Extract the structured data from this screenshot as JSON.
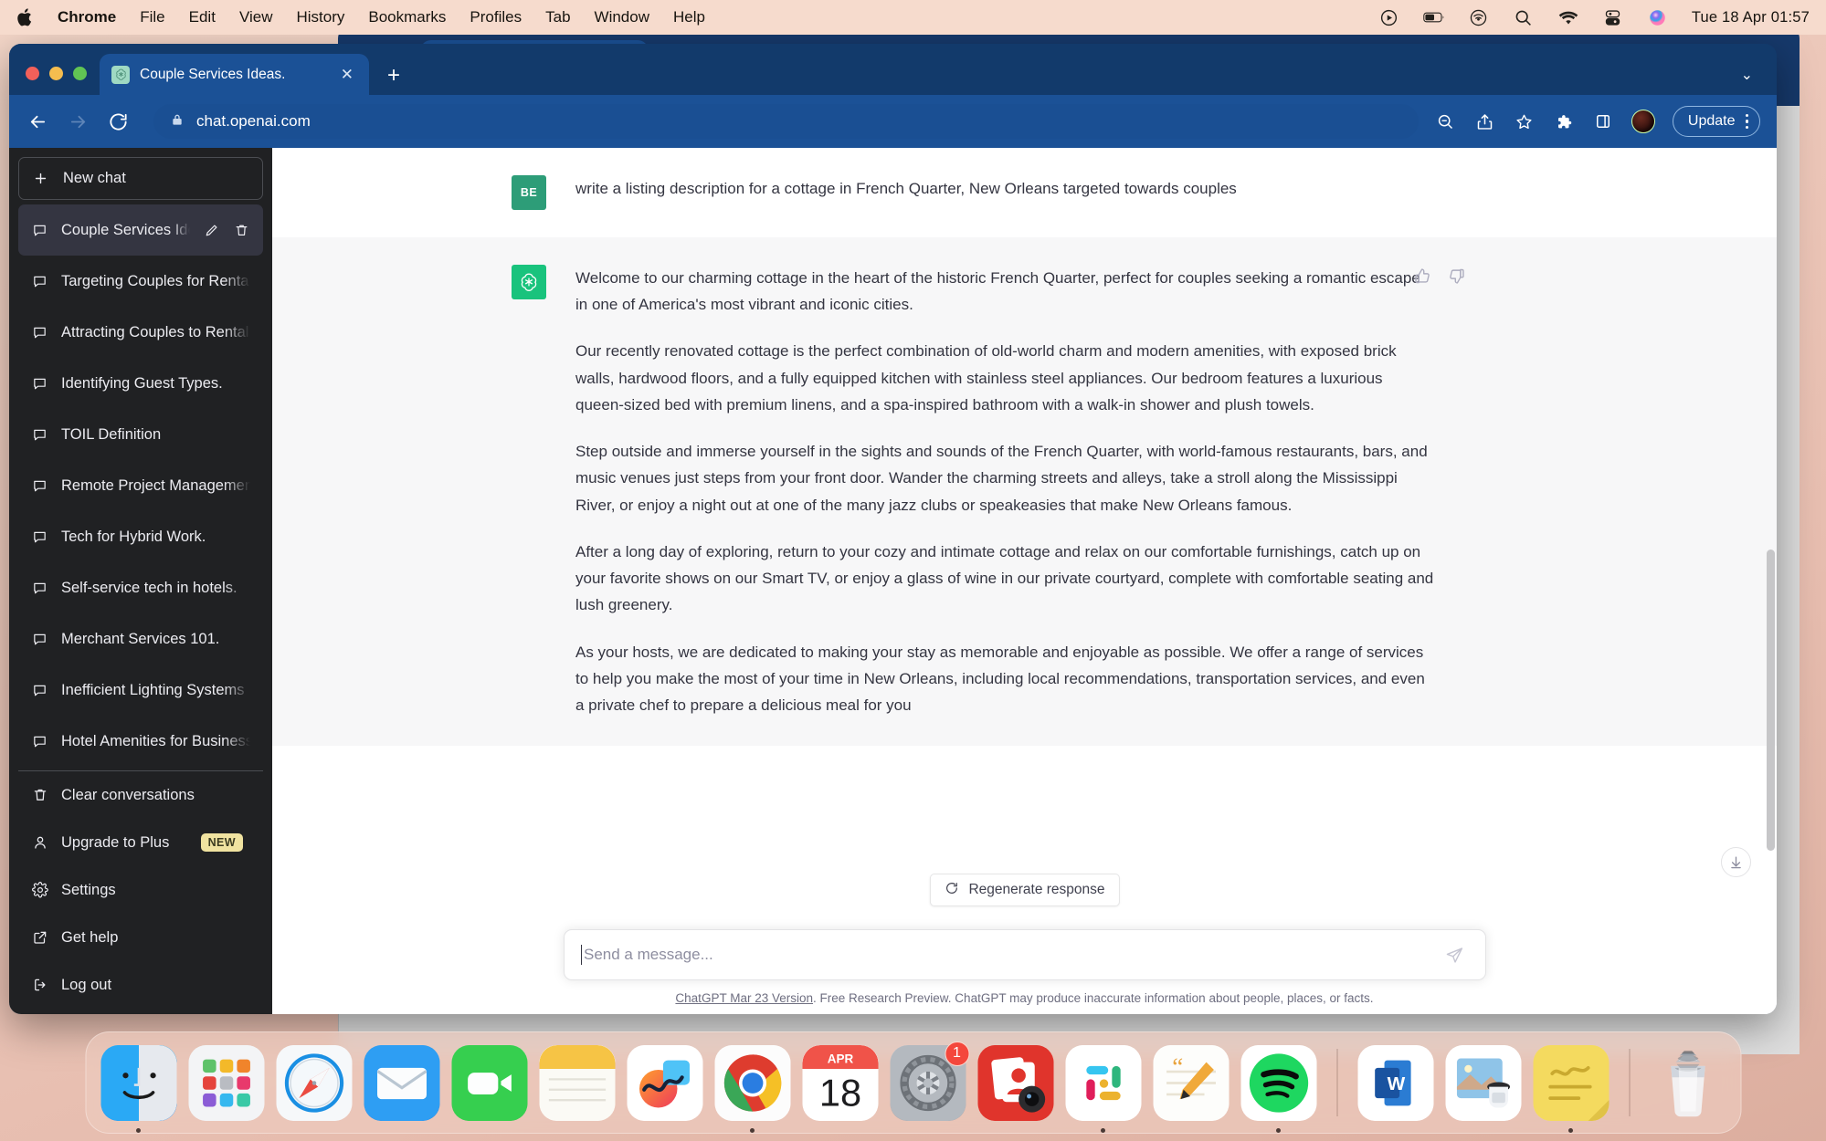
{
  "menubar": {
    "apple_icon": "apple-logo",
    "items": [
      {
        "label": "Chrome",
        "bold": true
      },
      {
        "label": "File",
        "bold": false
      },
      {
        "label": "Edit",
        "bold": false
      },
      {
        "label": "View",
        "bold": false
      },
      {
        "label": "History",
        "bold": false
      },
      {
        "label": "Bookmarks",
        "bold": false
      },
      {
        "label": "Profiles",
        "bold": false
      },
      {
        "label": "Tab",
        "bold": false
      },
      {
        "label": "Window",
        "bold": false
      },
      {
        "label": "Help",
        "bold": false
      }
    ],
    "status_icons": [
      "screen-record-icon",
      "battery-icon",
      "airplay-icon",
      "search-icon",
      "wifi-icon",
      "control-center-icon",
      "siri-icon"
    ],
    "clock": "Tue 18 Apr  01:57"
  },
  "browser": {
    "tab": {
      "title": "Couple Services Ideas.",
      "favicon": "chatgpt-icon",
      "close_label": "✕"
    },
    "new_tab_label": "+",
    "tabstrip_chevron": "˅",
    "nav": {
      "back_icon": "back-arrow-icon",
      "forward_icon": "forward-arrow-icon",
      "reload_icon": "reload-icon"
    },
    "omnibox": {
      "lock_icon": "lock-icon",
      "url": "chat.openai.com"
    },
    "toolbar_icons": [
      "zoom-out-icon",
      "share-icon",
      "bookmark-star-icon",
      "extensions-puzzle-icon",
      "side-panel-icon"
    ],
    "avatar": "profile-avatar",
    "update_button": "Update",
    "menu_icon": "kebab-menu-icon"
  },
  "sidebar": {
    "new_chat": "New chat",
    "conversations": [
      {
        "label": "Couple Services Ideas.",
        "active": true
      },
      {
        "label": "Targeting Couples for Rentals.",
        "active": false
      },
      {
        "label": "Attracting Couples to Rentals",
        "active": false
      },
      {
        "label": "Identifying Guest Types.",
        "active": false
      },
      {
        "label": "TOIL Definition",
        "active": false
      },
      {
        "label": "Remote Project Management",
        "active": false
      },
      {
        "label": "Tech for Hybrid Work.",
        "active": false
      },
      {
        "label": "Self-service tech in hotels.",
        "active": false
      },
      {
        "label": "Merchant Services 101.",
        "active": false
      },
      {
        "label": "Inefficient Lighting Systems",
        "active": false
      },
      {
        "label": "Hotel Amenities for Business",
        "active": false
      }
    ],
    "footer": [
      {
        "label": "Clear conversations",
        "icon": "trash-icon",
        "badge": ""
      },
      {
        "label": "Upgrade to Plus",
        "icon": "person-icon",
        "badge": "NEW"
      },
      {
        "label": "Settings",
        "icon": "gear-icon",
        "badge": ""
      },
      {
        "label": "Get help",
        "icon": "external-link-icon",
        "badge": ""
      },
      {
        "label": "Log out",
        "icon": "logout-icon",
        "badge": ""
      }
    ]
  },
  "chat": {
    "user": {
      "avatar_initials": "BE",
      "avatar_color": "#2d9d78",
      "message": "write a  listing description for a cottage in French Quarter,  New Orleans targeted towards couples"
    },
    "assistant": {
      "avatar_icon": "chatgpt-icon",
      "avatar_color": "#19c37d",
      "paragraphs": [
        "Welcome to our charming cottage in the heart of the historic French Quarter, perfect for couples seeking a romantic escape in one of America's most vibrant and iconic cities.",
        "Our recently renovated cottage is the perfect combination of old-world charm and modern amenities, with exposed brick walls, hardwood floors, and a fully equipped kitchen with stainless steel appliances. Our bedroom features a luxurious queen-sized bed with premium linens, and a spa-inspired bathroom with a walk-in shower and plush towels.",
        "Step outside and immerse yourself in the sights and sounds of the French Quarter, with world-famous restaurants, bars, and music venues just steps from your front door. Wander the charming streets and alleys, take a stroll along the Mississippi River, or enjoy a night out at one of the many jazz clubs or speakeasies that make New Orleans famous.",
        "After a long day of exploring, return to your cozy and intimate cottage and relax on our comfortable furnishings, catch up on your favorite shows on our Smart TV, or enjoy a glass of wine in our private courtyard, complete with comfortable seating and lush greenery.",
        "As your hosts, we are dedicated to making your stay as memorable and enjoyable as possible. We offer a range of services to help you make the most of your time in New Orleans, including local recommendations, transportation services, and even a private chef to prepare a delicious meal for you"
      ],
      "thumbs_up_icon": "thumbs-up-icon",
      "thumbs_down_icon": "thumbs-down-icon"
    },
    "regenerate_label": "Regenerate response",
    "composer_placeholder": "Send a message...",
    "composer_value": "",
    "send_icon": "send-paper-plane-icon",
    "scroll_bottom_icon": "scroll-to-bottom-icon",
    "legal_link": "ChatGPT Mar 23 Version",
    "legal_rest": ". Free Research Preview. ChatGPT may produce inaccurate information about people, places, or facts."
  },
  "dock": {
    "apps": [
      {
        "name": "finder",
        "running": true,
        "badge": ""
      },
      {
        "name": "launchpad",
        "running": false,
        "badge": ""
      },
      {
        "name": "safari",
        "running": false,
        "badge": ""
      },
      {
        "name": "mail",
        "running": false,
        "badge": ""
      },
      {
        "name": "facetime",
        "running": false,
        "badge": ""
      },
      {
        "name": "notes",
        "running": false,
        "badge": ""
      },
      {
        "name": "freeform",
        "running": false,
        "badge": ""
      },
      {
        "name": "chrome",
        "running": true,
        "badge": ""
      },
      {
        "name": "calendar",
        "running": false,
        "badge": "",
        "month": "APR",
        "day": "18"
      },
      {
        "name": "system-settings",
        "running": false,
        "badge": "1"
      },
      {
        "name": "contacts-photobooth",
        "running": false,
        "badge": ""
      },
      {
        "name": "slack",
        "running": true,
        "badge": ""
      },
      {
        "name": "pages",
        "running": false,
        "badge": ""
      },
      {
        "name": "spotify",
        "running": true,
        "badge": ""
      },
      {
        "name": "microsoft-word",
        "running": false,
        "badge": ""
      },
      {
        "name": "preview",
        "running": false,
        "badge": ""
      },
      {
        "name": "stickies",
        "running": true,
        "badge": ""
      },
      {
        "name": "trash",
        "running": false,
        "badge": ""
      }
    ]
  }
}
